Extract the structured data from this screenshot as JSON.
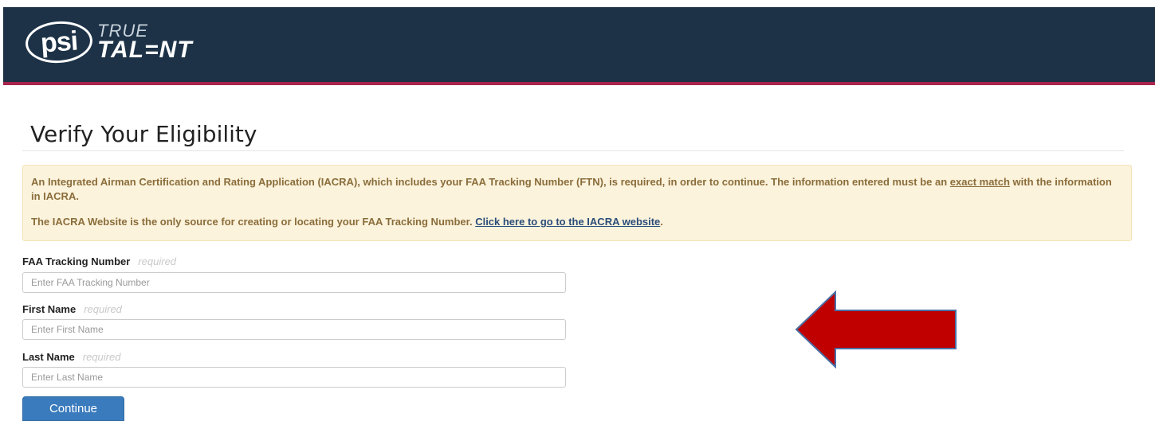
{
  "header": {
    "logo": {
      "mark": "psi",
      "line1": "TRUE",
      "line2": "TAL=NT"
    }
  },
  "page": {
    "title": "Verify Your Eligibility"
  },
  "notice": {
    "para1_before": "An Integrated Airman Certification and Rating Application (IACRA), which includes your FAA Tracking Number (FTN), is required, in order to continue. The information entered must be an ",
    "para1_link": "exact match",
    "para1_after": " with the information in IACRA.",
    "para2_before": "The IACRA Website is the only source for creating or locating your FAA Tracking Number. ",
    "para2_link": "Click here to go to the IACRA website",
    "para2_after": "."
  },
  "form": {
    "ftn": {
      "label": "FAA Tracking Number",
      "required": "required",
      "placeholder": "Enter FAA Tracking Number",
      "value": ""
    },
    "first_name": {
      "label": "First Name",
      "required": "required",
      "placeholder": "Enter First Name",
      "value": ""
    },
    "last_name": {
      "label": "Last Name",
      "required": "required",
      "placeholder": "Enter Last Name",
      "value": ""
    },
    "continue_label": "Continue"
  },
  "colors": {
    "header_bg": "#1d3247",
    "header_accent": "#a8244c",
    "notice_bg": "#fcf3dc",
    "notice_text": "#8a6d3b",
    "button_bg": "#3a7bbd",
    "arrow_fill": "#c00000",
    "arrow_stroke": "#4a6fa5"
  },
  "annotation": {
    "icon": "left-arrow-icon"
  }
}
